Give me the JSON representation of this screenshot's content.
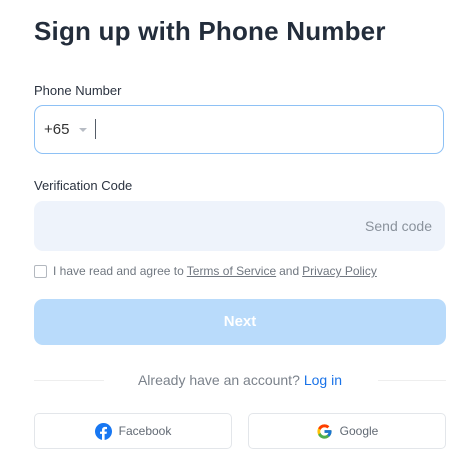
{
  "header": {
    "title": "Sign up with Phone Number"
  },
  "phone": {
    "label": "Phone Number",
    "country_code": "+65",
    "value": "",
    "placeholder": ""
  },
  "verification": {
    "label": "Verification Code",
    "value": "",
    "placeholder": "",
    "send_code_label": "Send code"
  },
  "agreement": {
    "checked": false,
    "text": "I have read and agree to",
    "terms_label": "Terms of Service",
    "and_text": "and",
    "privacy_label": "Privacy Policy"
  },
  "next_button": {
    "label": "Next"
  },
  "account": {
    "text": "Already have an account?",
    "login_label": "Log in"
  },
  "social": {
    "facebook_label": "Facebook",
    "google_label": "Google"
  },
  "colors": {
    "accent": "#1a73e8",
    "next_button_disabled": "#b9dbfb",
    "focused_border": "#8ec1f5",
    "input_background": "#eef3fb",
    "facebook_blue": "#1877f2"
  },
  "icons": {
    "country_dropdown": "chevron-down-icon",
    "facebook": "facebook-icon",
    "google": "google-icon"
  }
}
